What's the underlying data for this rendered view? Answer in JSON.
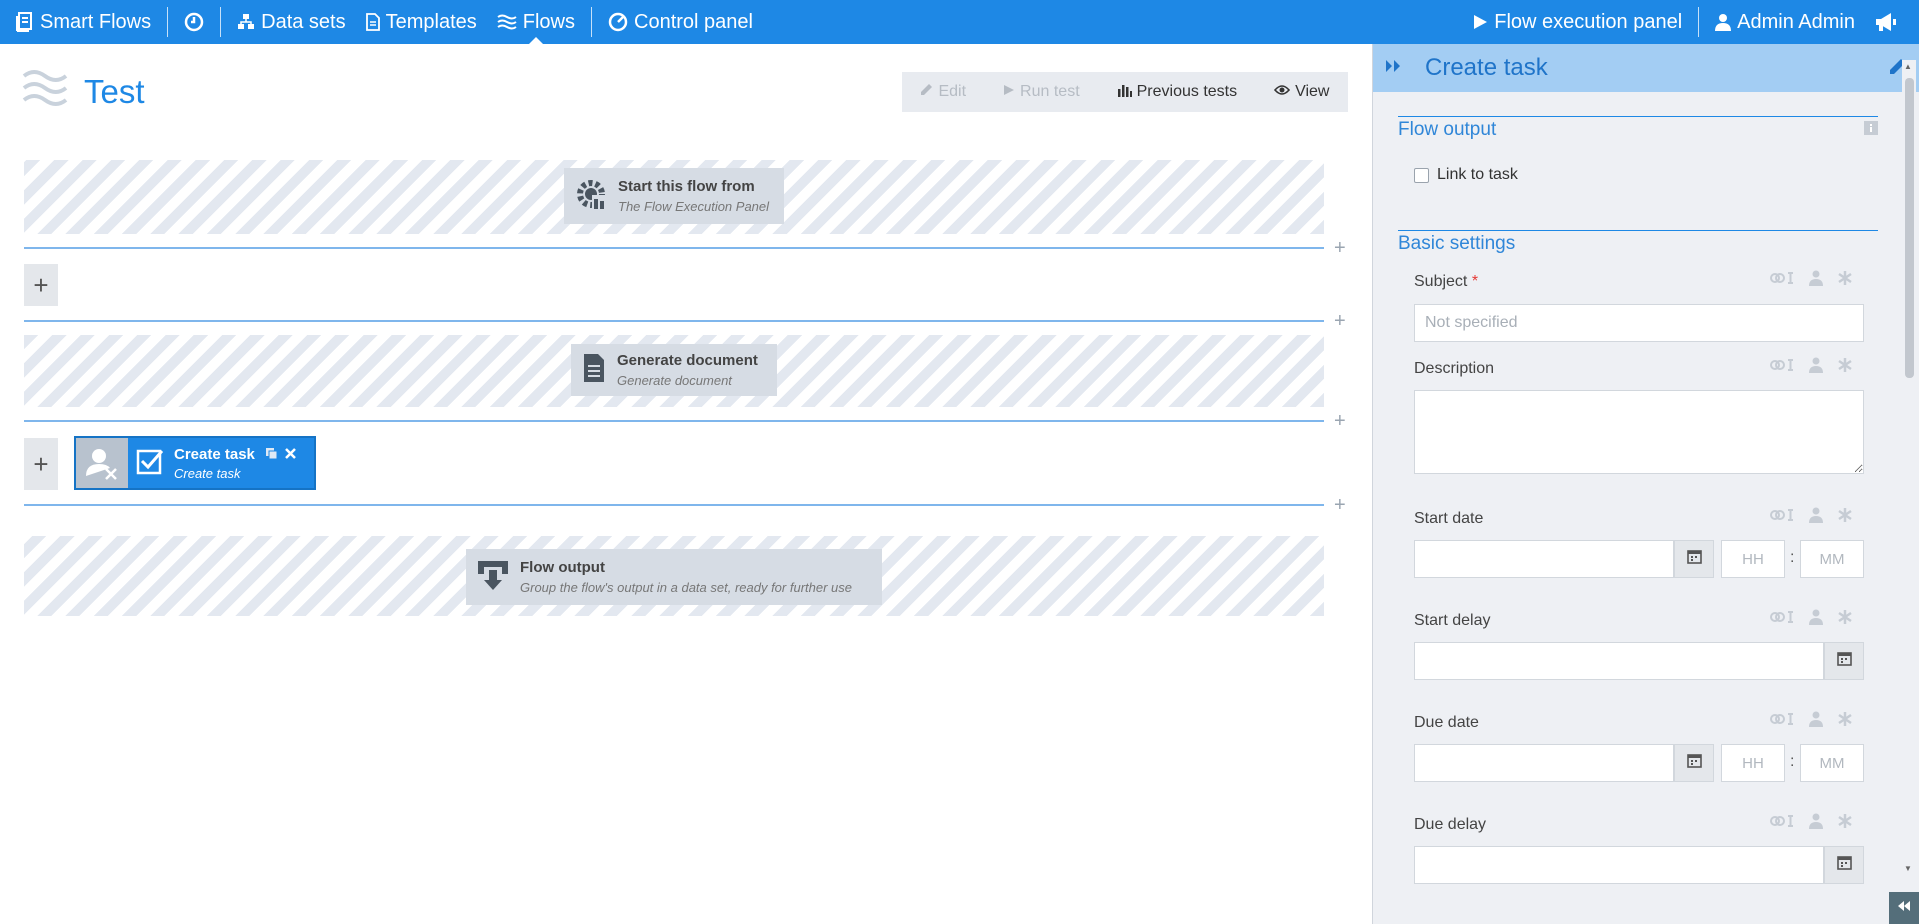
{
  "topbar": {
    "brand": "Smart Flows",
    "nav": [
      "Data sets",
      "Templates",
      "Flows",
      "Control panel"
    ],
    "flow_exec": "Flow execution panel",
    "user": "Admin Admin"
  },
  "main": {
    "flow_title": "Test",
    "toolbar": {
      "edit": "Edit",
      "run_test": "Run test",
      "previous_tests": "Previous tests",
      "view": "View"
    },
    "plus_symbol": "+",
    "nodes": {
      "start": {
        "title": "Start this flow from",
        "subtitle": "The Flow Execution Panel"
      },
      "generate": {
        "title": "Generate document",
        "subtitle": "Generate document"
      },
      "task": {
        "title": "Create task",
        "subtitle": "Create task"
      },
      "output": {
        "title": "Flow output",
        "subtitle": "Group the flow's output in a data set, ready for further use"
      }
    }
  },
  "panel": {
    "title": "Create task",
    "flow_output": {
      "title": "Flow output",
      "link_to_task": "Link to task"
    },
    "basic_settings": {
      "title": "Basic settings",
      "subject": {
        "label": "Subject",
        "required_mark": "*",
        "placeholder": "Not specified"
      },
      "description": {
        "label": "Description"
      },
      "start_date": {
        "label": "Start date",
        "hh": "HH",
        "mm": "MM"
      },
      "start_delay": {
        "label": "Start delay"
      },
      "due_date": {
        "label": "Due date",
        "hh": "HH",
        "mm": "MM"
      },
      "due_delay": {
        "label": "Due delay"
      },
      "time_separator": ":"
    }
  },
  "colors": {
    "primary": "#1e88e5",
    "panel_header": "#a3cdf3",
    "panel_bg": "#eef0f4",
    "node_bg": "#d6dce4"
  }
}
